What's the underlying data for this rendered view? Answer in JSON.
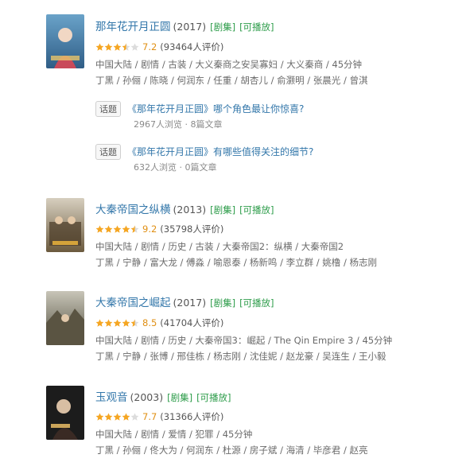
{
  "items": [
    {
      "title": "那年花开月正圆",
      "year": "(2017)",
      "tags": [
        "[剧集]",
        "[可播放]"
      ],
      "stars": 3.5,
      "score": "7.2",
      "rating_count": "(93464人评价)",
      "meta1": "中国大陆 / 剧情 / 古装 / 大义秦商之安吴寡妇 / 大义秦商 / 45分钟",
      "meta2": "丁黑 / 孙俪 / 陈晓 / 何润东 / 任重 / 胡杏儿 / 俞灏明 / 张晨光 / 曾淇",
      "topics": [
        {
          "badge": "话题",
          "title": "《那年花开月正圆》哪个角色最让你惊喜?",
          "stats": "2967人浏览 · 8篇文章"
        },
        {
          "badge": "话题",
          "title": "《那年花开月正圆》有哪些值得关注的细节?",
          "stats": "632人浏览 · 0篇文章"
        }
      ]
    },
    {
      "title": "大秦帝国之纵横",
      "year": "(2013)",
      "tags": [
        "[剧集]",
        "[可播放]"
      ],
      "stars": 4.5,
      "score": "9.2",
      "rating_count": "(35798人评价)",
      "meta1": "中国大陆 / 剧情 / 历史 / 古装 / 大秦帝国2：纵横 / 大秦帝国2",
      "meta2": "丁黑 / 宁静 / 富大龙 / 傅淼 / 喻恩泰 / 杨新鸣 / 李立群 / 姚橹 / 杨志刚"
    },
    {
      "title": "大秦帝国之崛起",
      "year": "(2017)",
      "tags": [
        "[剧集]",
        "[可播放]"
      ],
      "stars": 4.5,
      "score": "8.5",
      "rating_count": "(41704人评价)",
      "meta1": "中国大陆 / 剧情 / 历史 / 大秦帝国3：崛起 / The Qin Empire 3 / 45分钟",
      "meta2": "丁黑 / 宁静 / 张博 / 邢佳栋 / 杨志刚 / 沈佳妮 / 赵龙豪 / 吴连生 / 王小毅"
    },
    {
      "title": "玉观音",
      "year": "(2003)",
      "tags": [
        "[剧集]",
        "[可播放]"
      ],
      "stars": 4,
      "score": "7.7",
      "rating_count": "(31366人评价)",
      "meta1": "中国大陆 / 剧情 / 爱情 / 犯罪 / 45分钟",
      "meta2": "丁黑 / 孙俪 / 佟大为 / 何润东 / 杜源 / 房子斌 / 海清 / 毕彦君 / 赵亮"
    }
  ],
  "colors": {
    "link": "#3377aa",
    "tag": "#2d9c4a",
    "star": "#f5a623",
    "score": "#e09015"
  }
}
